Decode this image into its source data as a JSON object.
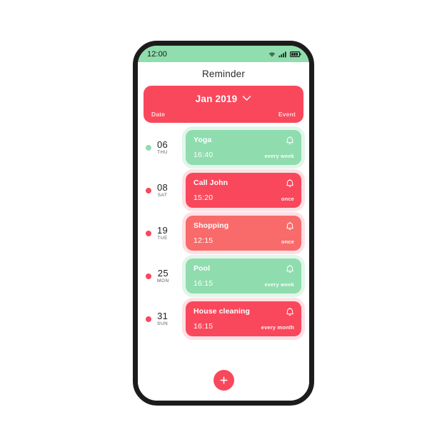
{
  "colors": {
    "red": "#f9485c",
    "red_light": "#f96a6a",
    "green": "#90ddae",
    "green_card": "#8fdcaf",
    "frame": "#1c1c1c",
    "label_muted": "#ffd9de"
  },
  "status_bar": {
    "time": "12:00",
    "icons": [
      "wifi-icon",
      "cellular-signal-icon",
      "battery-icon"
    ]
  },
  "app": {
    "title": "Reminder"
  },
  "header": {
    "month": "Jan 2019",
    "chevron_icon": "chevron-down-icon",
    "date_column_label": "Date",
    "event_column_label": "Event"
  },
  "reminders": [
    {
      "day": "06",
      "weekday": "THU",
      "dot_color": "#90ddae",
      "card_color": "#8fdcaf",
      "theme": "green",
      "title": "Yoga",
      "time": "16:40",
      "repeat": "every week",
      "alarm_icon": "bell-icon"
    },
    {
      "day": "08",
      "weekday": "SAT",
      "dot_color": "#f9485c",
      "card_color": "#f9485c",
      "theme": "red",
      "title": "Call John",
      "time": "15:20",
      "repeat": "once",
      "alarm_icon": "bell-icon"
    },
    {
      "day": "19",
      "weekday": "TUE",
      "dot_color": "#f9485c",
      "card_color": "#f96a6a",
      "theme": "red",
      "title": "Shopping",
      "time": "12:15",
      "repeat": "once",
      "alarm_icon": "bell-icon"
    },
    {
      "day": "25",
      "weekday": "MON",
      "dot_color": "#f9485c",
      "card_color": "#8fdcaf",
      "theme": "green",
      "title": "Pool",
      "time": "16:15",
      "repeat": "every week",
      "alarm_icon": "bell-icon"
    },
    {
      "day": "31",
      "weekday": "SUN",
      "dot_color": "#f9485c",
      "card_color": "#f9485c",
      "theme": "red",
      "title": "House cleaning",
      "time": "16:15",
      "repeat": "every month",
      "alarm_icon": "bell-icon"
    }
  ],
  "fab": {
    "icon": "plus-icon",
    "label": "+"
  }
}
